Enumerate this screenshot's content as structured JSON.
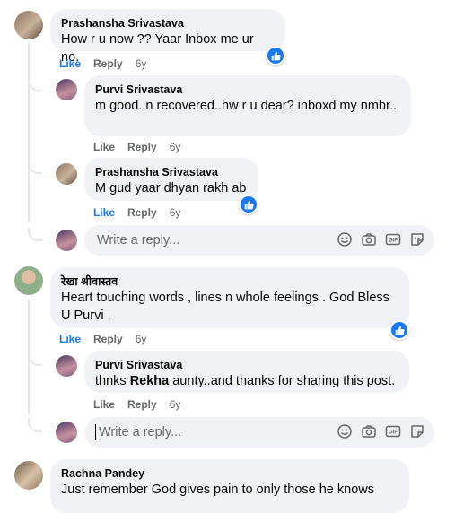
{
  "comments": [
    {
      "author": "Prashansha Srivastava",
      "text": "How r u now ?? Yaar Inbox me ur no.",
      "like": "Like",
      "reply": "Reply",
      "time": "6y",
      "replies": [
        {
          "author": "Purvi Srivastava",
          "text": "m good..n recovered..hw r u dear? inboxd my nmbr..",
          "like": "Like",
          "reply": "Reply",
          "time": "6y"
        },
        {
          "author": "Prashansha Srivastava",
          "text": "M gud yaar dhyan rakh ab",
          "like": "Like",
          "reply": "Reply",
          "time": "6y"
        }
      ],
      "reply_placeholder": "Write a reply..."
    },
    {
      "author": "रेखा श्रीवास्तव",
      "text": "Heart touching words , lines n whole feelings . God Bless U Purvi .",
      "like": "Like",
      "reply": "Reply",
      "time": "6y",
      "replies": [
        {
          "author": "Purvi Srivastava",
          "text_before": "thnks ",
          "text_bold": "Rekha",
          "text_after": " aunty..and thanks for sharing this post.",
          "like": "Like",
          "reply": "Reply",
          "time": "6y"
        }
      ],
      "reply_placeholder": "Write a reply..."
    },
    {
      "author": "Rachna Pandey",
      "text": "Just remember God gives pain to only those he knows"
    }
  ],
  "icons": {
    "like_badge": "thumbs-up-icon",
    "emoji": "smiley-icon",
    "camera": "camera-icon",
    "gif": "gif-icon",
    "sticker": "sticker-icon"
  },
  "colors": {
    "link_blue": "#1877f2",
    "bubble_bg": "#f0f2f5",
    "meta_gray": "#65676b"
  }
}
